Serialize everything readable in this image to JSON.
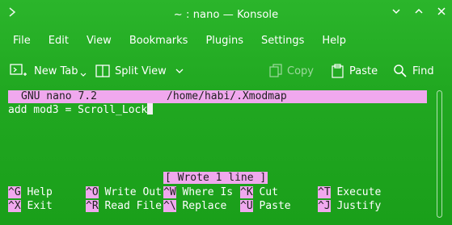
{
  "window": {
    "title": "~ : nano — Konsole",
    "controls": [
      "minimize",
      "maximize",
      "close"
    ]
  },
  "menu": {
    "items": [
      "File",
      "Edit",
      "View",
      "Bookmarks",
      "Plugins",
      "Settings",
      "Help"
    ]
  },
  "toolbar": {
    "new_tab": "New Tab",
    "split_view": "Split View",
    "copy": "Copy",
    "paste": "Paste",
    "find": "Find"
  },
  "nano": {
    "version": "GNU nano 7.2",
    "file_path": "/home/habi/.Xmodmap",
    "content": "add mod3 = Scroll_Lock",
    "status": "[ Wrote 1 line ]",
    "shortcuts": [
      {
        "key": "^G",
        "label": "Help"
      },
      {
        "key": "^X",
        "label": "Exit"
      },
      {
        "key": "^O",
        "label": "Write Out"
      },
      {
        "key": "^R",
        "label": "Read File"
      },
      {
        "key": "^W",
        "label": "Where Is"
      },
      {
        "key": "^\\",
        "label": "Replace"
      },
      {
        "key": "^K",
        "label": "Cut"
      },
      {
        "key": "^U",
        "label": "Paste"
      },
      {
        "key": "^T",
        "label": "Execute"
      },
      {
        "key": "^J",
        "label": "Justify"
      }
    ]
  },
  "colors": {
    "background": "#1fa81f",
    "highlight": "#f0a8ee",
    "text": "#ffffff"
  }
}
